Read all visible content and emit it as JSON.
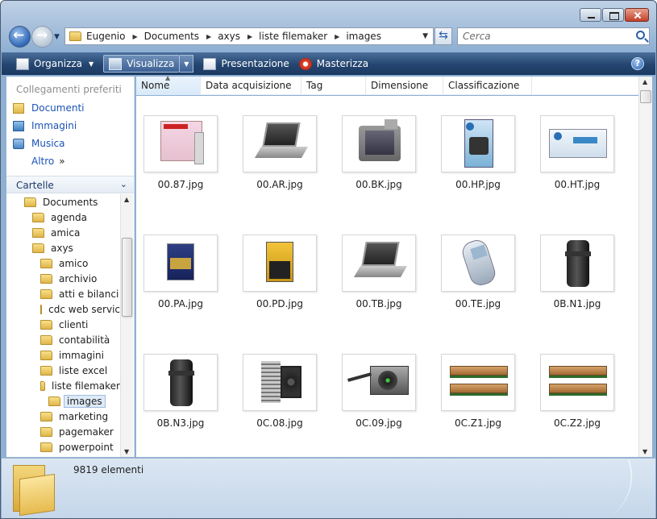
{
  "address": {
    "crumbs": [
      "Eugenio",
      "Documents",
      "axys",
      "liste filemaker",
      "images"
    ]
  },
  "search": {
    "placeholder": "Cerca"
  },
  "commands": {
    "organize": "Organizza",
    "view": "Visualizza",
    "slideshow": "Presentazione",
    "burn": "Masterizza"
  },
  "left_pane": {
    "favorites_header": "Collegamenti preferiti",
    "favorites": [
      "Documenti",
      "Immagini",
      "Musica"
    ],
    "more": "Altro",
    "folders_header": "Cartelle",
    "tree": [
      {
        "label": "Documents",
        "level": 0
      },
      {
        "label": "agenda",
        "level": 1
      },
      {
        "label": "amica",
        "level": 1
      },
      {
        "label": "axys",
        "level": 1
      },
      {
        "label": "amico",
        "level": 2
      },
      {
        "label": "archivio",
        "level": 2
      },
      {
        "label": "atti e bilanci",
        "level": 2
      },
      {
        "label": "cdc web servic",
        "level": 2
      },
      {
        "label": "clienti",
        "level": 2
      },
      {
        "label": "contabilità",
        "level": 2
      },
      {
        "label": "immagini",
        "level": 2
      },
      {
        "label": "liste excel",
        "level": 2
      },
      {
        "label": "liste filemaker",
        "level": 2
      },
      {
        "label": "images",
        "level": 3,
        "selected": true
      },
      {
        "label": "marketing",
        "level": 2
      },
      {
        "label": "pagemaker",
        "level": 2
      },
      {
        "label": "powerpoint",
        "level": 2
      }
    ]
  },
  "columns": [
    "Nome",
    "Data acquisizione",
    "Tag",
    "Dimensione",
    "Classificazione"
  ],
  "files": [
    {
      "name": "00.87.jpg",
      "icon": "box-product-thumb"
    },
    {
      "name": "00.AR.jpg",
      "icon": "laptop-thumb"
    },
    {
      "name": "00.BK.jpg",
      "icon": "gps-device-thumb"
    },
    {
      "name": "00.HP.jpg",
      "icon": "ink-cartridge-thumb"
    },
    {
      "name": "00.HT.jpg",
      "icon": "toner-box-thumb"
    },
    {
      "name": "00.PA.jpg",
      "icon": "sony-battery-thumb"
    },
    {
      "name": "00.PD.jpg",
      "icon": "duracell-battery-thumb"
    },
    {
      "name": "00.TB.jpg",
      "icon": "laptop-thumb"
    },
    {
      "name": "00.TE.jpg",
      "icon": "mobile-phone-thumb"
    },
    {
      "name": "0B.N1.jpg",
      "icon": "camera-lens-thumb"
    },
    {
      "name": "0B.N3.jpg",
      "icon": "camera-lens-thumb"
    },
    {
      "name": "0C.08.jpg",
      "icon": "cpu-cooler-thumb"
    },
    {
      "name": "0C.09.jpg",
      "icon": "power-supply-thumb"
    },
    {
      "name": "0C.Z1.jpg",
      "icon": "ram-modules-thumb"
    },
    {
      "name": "0C.Z2.jpg",
      "icon": "ram-modules-thumb"
    }
  ],
  "details": {
    "count": "9819 elementi"
  }
}
